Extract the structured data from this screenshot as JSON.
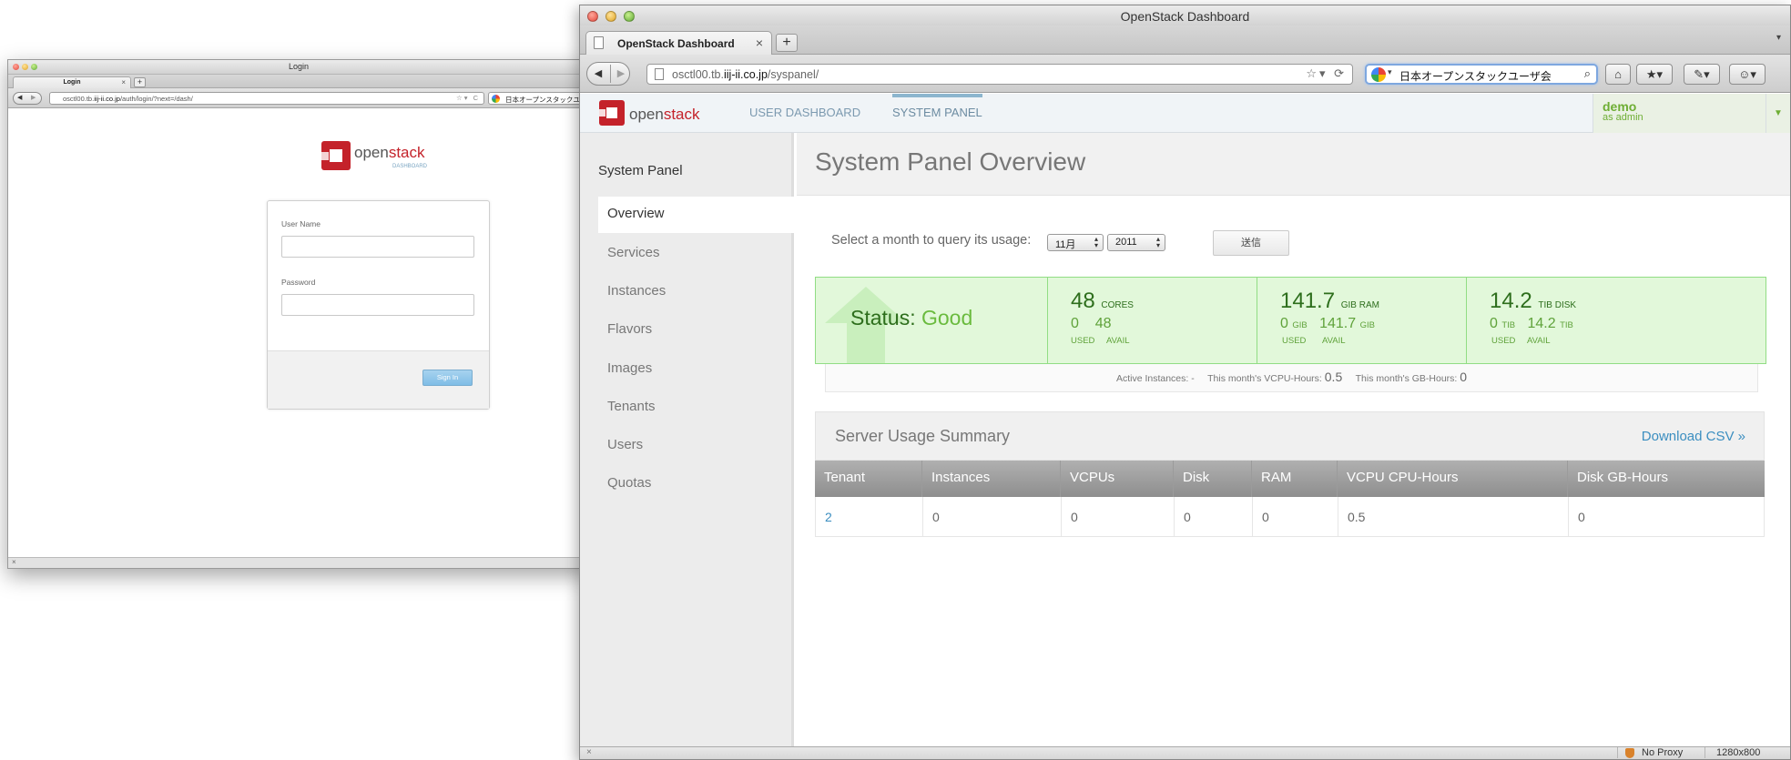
{
  "login_window": {
    "title": "Login",
    "tab_label": "Login",
    "url_prefix": "osctl00.tb.",
    "url_host": "iij-ii.co.jp",
    "url_path": "/auth/login/?next=/dash/",
    "search_text": "日本オープンスタックユ",
    "logo_text_a": "open",
    "logo_text_b": "stack",
    "logo_sub": "DASHBOARD",
    "username_label": "User Name",
    "password_label": "Password",
    "signin_label": "Sign In"
  },
  "main_window": {
    "title": "OpenStack Dashboard",
    "tab_label": "OpenStack Dashboard",
    "url_prefix": "osctl00.tb.",
    "url_host": "iij-ii.co.jp",
    "url_path": "/syspanel/",
    "search_text": "日本オープンスタックユーザ会",
    "status_proxy": "No Proxy",
    "status_resolution": "1280x800"
  },
  "header": {
    "logo_text_a": "open",
    "logo_text_b": "stack",
    "nav": [
      "USER DASHBOARD",
      "SYSTEM PANEL"
    ],
    "user_name": "demo",
    "user_role": "as admin"
  },
  "sidebar": {
    "title": "System Panel",
    "items": [
      "Overview",
      "Services",
      "Instances",
      "Flavors",
      "Images",
      "Tenants",
      "Users",
      "Quotas"
    ]
  },
  "main": {
    "page_title": "System Panel Overview",
    "query_label": "Select a month to query its usage:",
    "month_value": "11月",
    "year_value": "2011",
    "submit_label": "送信",
    "status": {
      "label": "Status:",
      "value": "Good",
      "cores": {
        "total": "48",
        "unit": "CORES",
        "used": "0",
        "avail": "48",
        "used_label": "USED",
        "avail_label": "AVAIL"
      },
      "ram": {
        "total": "141.7",
        "unit": "GIB RAM",
        "used": "0",
        "used_unit": "GIB",
        "avail": "141.7",
        "avail_unit": "GIB",
        "used_label": "USED",
        "avail_label": "AVAIL"
      },
      "disk": {
        "total": "14.2",
        "unit": "TIB DISK",
        "used": "0",
        "used_unit": "TIB",
        "avail": "14.2",
        "avail_unit": "TIB",
        "used_label": "USED",
        "avail_label": "AVAIL"
      }
    },
    "stats": {
      "active_label": "Active Instances:",
      "active_value": "-",
      "vcpu_label": "This month's VCPU-Hours:",
      "vcpu_value": "0.5",
      "gb_label": "This month's GB-Hours:",
      "gb_value": "0"
    },
    "summary": {
      "title": "Server Usage Summary",
      "download": "Download CSV »",
      "columns": [
        "Tenant",
        "Instances",
        "VCPUs",
        "Disk",
        "RAM",
        "VCPU CPU-Hours",
        "Disk GB-Hours"
      ],
      "rows": [
        [
          "2",
          "0",
          "0",
          "0",
          "0",
          "0.5",
          "0"
        ]
      ]
    }
  },
  "colors": {
    "status_green": "#e2f8da",
    "status_border": "#91dd84",
    "link_blue": "#3b8ec0",
    "brand_red": "#c4222a"
  }
}
